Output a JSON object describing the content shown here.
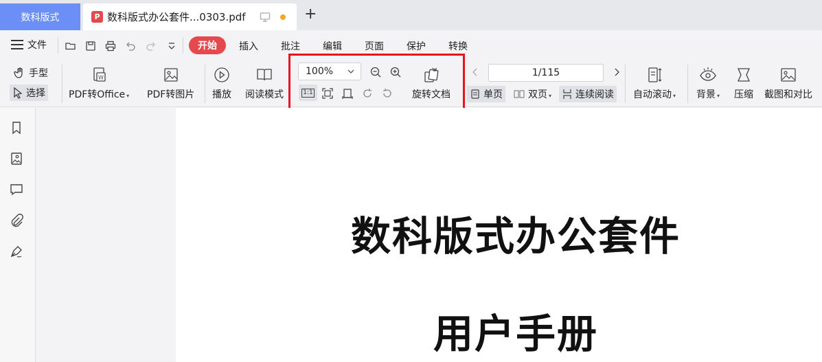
{
  "tabbar": {
    "app_tab": "数科版式",
    "doc_tab_icon": "P",
    "doc_tab_title": "数科版式办公套件...0303.pdf",
    "new_tab": "+"
  },
  "menu": {
    "file": "文件",
    "start": "开始",
    "items": [
      "插入",
      "批注",
      "编辑",
      "页面",
      "保护",
      "转换"
    ]
  },
  "ribbon": {
    "hand": "手型",
    "select": "选择",
    "pdf_to_office": "PDF转Office",
    "pdf_to_image": "PDF转图片",
    "play": "播放",
    "read_mode": "阅读模式",
    "zoom_value": "100%",
    "actual_size": "1:1",
    "rotate_doc": "旋转文档",
    "page_indicator": "1/115",
    "single_page": "单页",
    "double_page": "双页",
    "continuous": "连续阅读",
    "auto_scroll": "自动滚动",
    "background": "背景",
    "compress": "压缩",
    "compare": "截图和对比"
  },
  "document": {
    "title": "数科版式办公套件",
    "subtitle": "用户手册"
  },
  "colors": {
    "accent": "#6b8ff7",
    "start_button": "#e5484d",
    "highlight": "#e8131d"
  }
}
